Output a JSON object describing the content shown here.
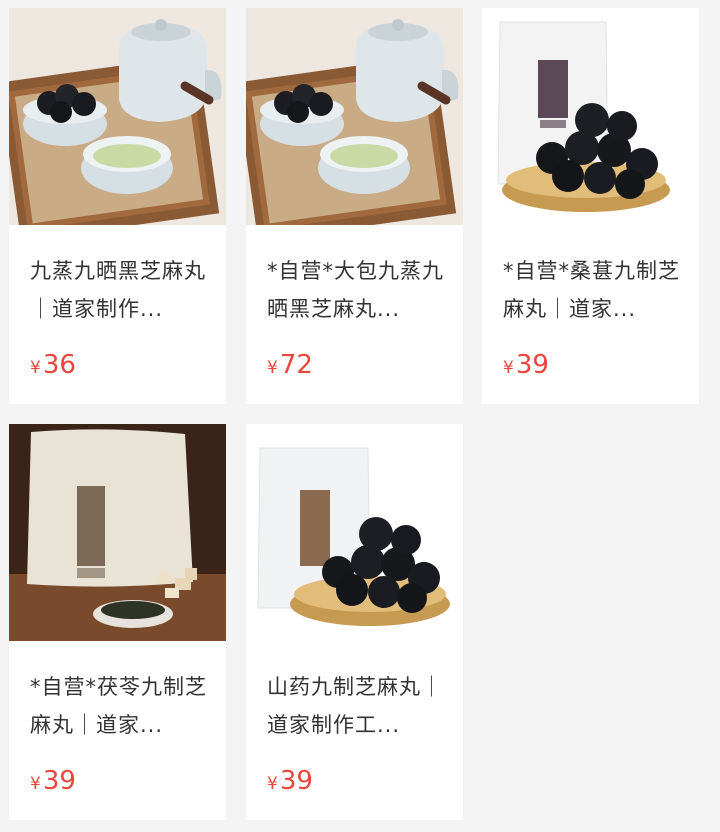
{
  "products": [
    {
      "title": "九蒸九晒黑芝麻丸｜道家制作...",
      "currency": "¥",
      "price": "36",
      "image": "tea-set-photo"
    },
    {
      "title": "*自营*大包九蒸九晒黑芝麻丸...",
      "currency": "¥",
      "price": "72",
      "image": "tea-set-photo"
    },
    {
      "title": "*自营*桑葚九制芝麻丸｜道家...",
      "currency": "¥",
      "price": "39",
      "image": "bag-and-bowl-photo"
    },
    {
      "title": "*自营*茯苓九制芝麻丸｜道家...",
      "currency": "¥",
      "price": "39",
      "image": "kraft-bag-on-wood-photo"
    },
    {
      "title": "山药九制芝麻丸｜道家制作工...",
      "currency": "¥",
      "price": "39",
      "image": "bag-and-bowl-photo"
    }
  ],
  "colors": {
    "price": "#e9463d",
    "title": "#333333",
    "background": "#f4f4f4",
    "card": "#ffffff"
  }
}
